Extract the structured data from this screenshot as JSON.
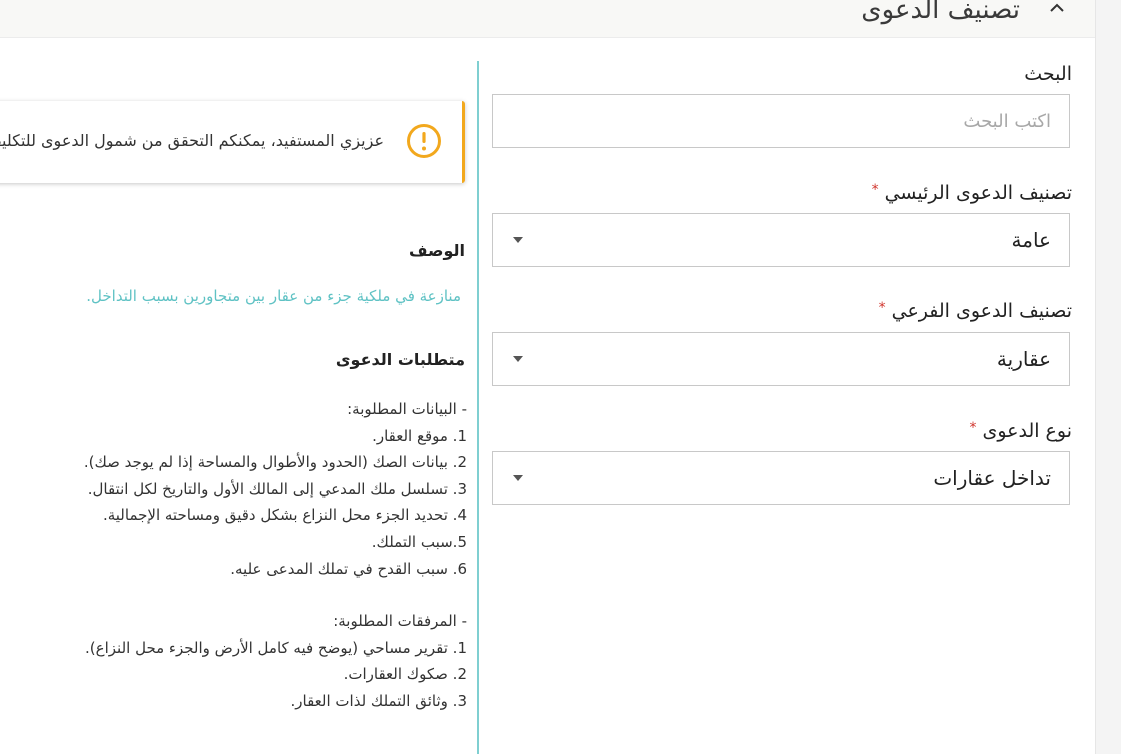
{
  "section": {
    "title": "تصنيف الدعوى"
  },
  "form": {
    "search": {
      "label": "البحث",
      "placeholder": "اكتب البحث"
    },
    "main_category": {
      "label": "تصنيف الدعوى الرئيسي",
      "required_mark": "*",
      "value": "عامة"
    },
    "sub_category": {
      "label": "تصنيف الدعوى الفرعي",
      "required_mark": "*",
      "value": "عقارية"
    },
    "case_type": {
      "label": "نوع الدعوى",
      "required_mark": "*",
      "value": "تداخل عقارات"
    }
  },
  "info": {
    "notice_text": "عزيزي المستفيد، يمكنكم التحقق من شمول الدعوى للتكليف",
    "description_heading": "الوصف",
    "description": "منازعة في ملكية جزء من عقار بين متجاورين بسبب التداخل.",
    "requirements_heading": "متطلبات الدعوى",
    "data_heading": "- البيانات المطلوبة:",
    "data_items": [
      "1. موقع العقار.",
      "2. بيانات الصك (الحدود والأطوال والمساحة إذا لم يوجد صك).",
      "3. تسلسل ملك المدعي إلى المالك الأول والتاريخ لكل انتقال.",
      "4. تحديد الجزء محل النزاع بشكل دقيق ومساحته الإجمالية.",
      "5.سبب التملك.",
      "6. سبب القدح في تملك المدعى عليه."
    ],
    "attachments_heading": "- المرفقات المطلوبة:",
    "attachment_items": [
      "1. تقرير مساحي (يوضح فيه كامل الأرض والجزء محل النزاع).",
      "2. صكوك العقارات.",
      "3. وثائق التملك لذات العقار."
    ]
  },
  "colors": {
    "accent_teal": "#5fc2c4",
    "divider_teal": "#7fcfd1",
    "warning": "#f2a81d",
    "required": "#d0342c"
  },
  "icons": {
    "collapse": "chevron-up-icon",
    "select": "caret-down-icon",
    "notice": "exclamation-circle-icon"
  }
}
